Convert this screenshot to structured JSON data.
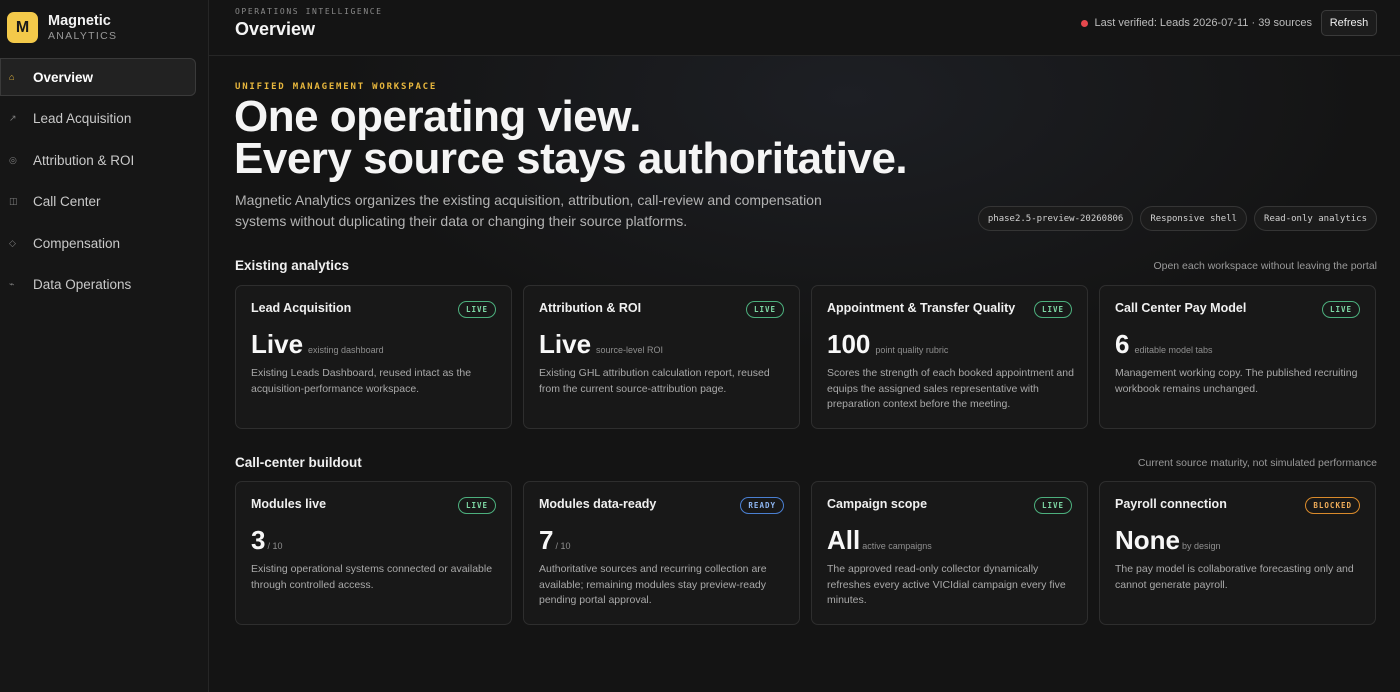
{
  "brand": {
    "logo_letter": "M",
    "name": "Magnetic",
    "sub": "ANALYTICS"
  },
  "nav": [
    {
      "label": "Overview",
      "icon": "⌂",
      "active": true
    },
    {
      "label": "Lead Acquisition",
      "icon": "↗",
      "active": false
    },
    {
      "label": "Attribution & ROI",
      "icon": "◎",
      "active": false
    },
    {
      "label": "Call Center",
      "icon": "◫",
      "active": false
    },
    {
      "label": "Compensation",
      "icon": "◇",
      "active": false
    },
    {
      "label": "Data Operations",
      "icon": "⌁",
      "active": false
    }
  ],
  "header": {
    "kicker": "OPERATIONS INTELLIGENCE",
    "title": "Overview",
    "verified_text": "Last verified: Leads 2026-07-11 · 39 sources",
    "refresh_label": "Refresh"
  },
  "hero": {
    "eyebrow": "UNIFIED MANAGEMENT WORKSPACE",
    "line1": "One operating view.",
    "line2": "Every source stays authoritative.",
    "lede": "Magnetic Analytics organizes the existing acquisition, attribution, call-review and compensation systems without duplicating their data or changing their source platforms.",
    "pills": [
      "phase2.5-preview-20260806",
      "Responsive shell",
      "Read-only analytics"
    ]
  },
  "existing": {
    "title": "Existing analytics",
    "note": "Open each workspace without leaving the portal",
    "cards": [
      {
        "title": "Lead Acquisition",
        "badge": "LIVE",
        "value": "Live",
        "unit": "existing dashboard",
        "desc": "Existing Leads Dashboard, reused intact as the acquisition-performance workspace."
      },
      {
        "title": "Attribution & ROI",
        "badge": "LIVE",
        "value": "Live",
        "unit": "source-level ROI",
        "desc": "Existing GHL attribution calculation report, reused from the current source-attribution page."
      },
      {
        "title": "Appointment & Transfer Quality",
        "badge": "LIVE",
        "value": "100",
        "unit": "point quality rubric",
        "desc": "Scores the strength of each booked appointment and equips the assigned sales representative with preparation context before the meeting."
      },
      {
        "title": "Call Center Pay Model",
        "badge": "LIVE",
        "value": "6",
        "unit": "editable model tabs",
        "desc": "Management working copy. The published recruiting workbook remains unchanged."
      }
    ]
  },
  "buildout": {
    "title": "Call-center buildout",
    "note": "Current source maturity, not simulated performance",
    "cards": [
      {
        "title": "Modules live",
        "badge": "LIVE",
        "value": "3",
        "unit": "/ 10",
        "desc": "Existing operational systems connected or available through controlled access."
      },
      {
        "title": "Modules data-ready",
        "badge": "READY",
        "value": "7",
        "unit": "/ 10",
        "desc": "Authoritative sources and recurring collection are available; remaining modules stay preview-ready pending portal approval."
      },
      {
        "title": "Campaign scope",
        "badge": "LIVE",
        "value": "All",
        "unit": "active campaigns",
        "desc": "The approved read-only collector dynamically refreshes every active VICIdial campaign every five minutes."
      },
      {
        "title": "Payroll connection",
        "badge": "BLOCKED",
        "value": "None",
        "unit": "by design",
        "desc": "The pay model is collaborative forecasting only and cannot generate payroll."
      }
    ]
  },
  "colors": {
    "accent": "#f3c94a",
    "live": "#7fd9a6",
    "ready": "#8eb6f2",
    "blocked": "#f0ad59",
    "status_dot": "#e5484d"
  }
}
